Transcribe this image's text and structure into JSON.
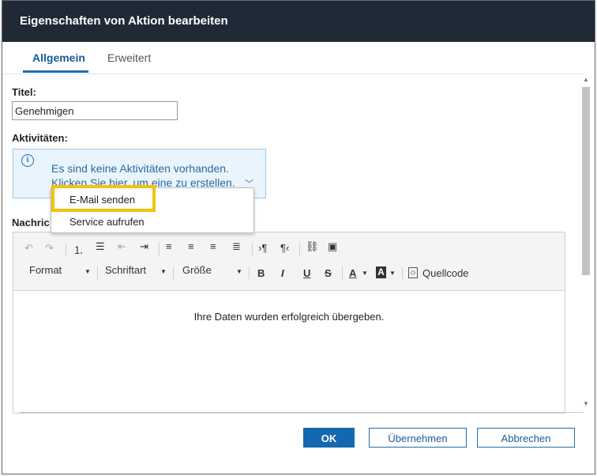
{
  "dialog": {
    "title": "Eigenschaften von Aktion bearbeiten",
    "tabs": [
      {
        "label": "Allgemein"
      },
      {
        "label": "Erweitert"
      }
    ]
  },
  "form": {
    "title_label": "Titel:",
    "title_value": "Genehmigen",
    "activities_label": "Aktivitäten:",
    "info_line1": "Es sind keine Aktivitäten vorhanden.",
    "info_line2": "Klicken Sie hier, um eine zu erstellen.",
    "message_label": "Nachric"
  },
  "dropdown": {
    "items": [
      {
        "label": "E-Mail senden"
      },
      {
        "label": "Service aufrufen"
      }
    ]
  },
  "editor": {
    "format_label": "Format",
    "font_label": "Schriftart",
    "size_label": "Größe",
    "bold": "B",
    "italic": "I",
    "underline": "U",
    "strike": "S",
    "font_color": "A",
    "bg_color": "A",
    "source_label": "Quellcode",
    "content": "Ihre Daten wurden erfolgreich übergeben."
  },
  "footer": {
    "ok": "OK",
    "apply": "Übernehmen",
    "cancel": "Abbrechen"
  },
  "colors": {
    "titlebar": "#1f2a36",
    "accent": "#1a6fb5",
    "highlight": "#f4c20d"
  }
}
